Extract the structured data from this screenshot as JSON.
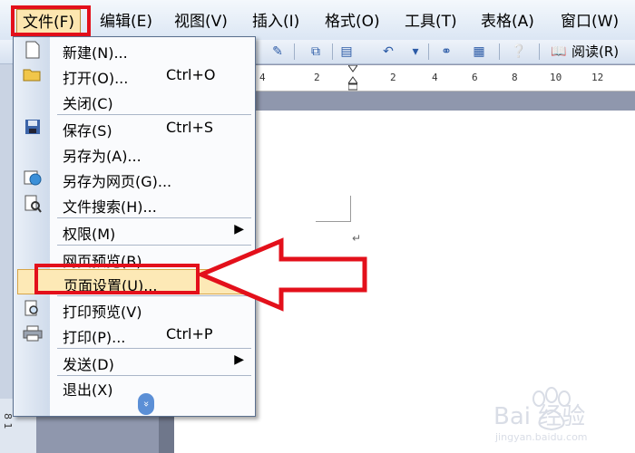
{
  "menubar": {
    "items": [
      {
        "label": "文件(F)",
        "open": true
      },
      {
        "label": "编辑(E)"
      },
      {
        "label": "视图(V)"
      },
      {
        "label": "插入(I)"
      },
      {
        "label": "格式(O)"
      },
      {
        "label": "工具(T)"
      },
      {
        "label": "表格(A)"
      },
      {
        "label": "窗口(W)"
      }
    ]
  },
  "toolbar": {
    "read_label": "阅读(R)",
    "icons": [
      "research-icon",
      "copy-icon",
      "undo-icon",
      "dropdown-arrow-icon",
      "hyperlink-icon",
      "table-icon",
      "help-icon",
      "book-icon"
    ]
  },
  "ruler": {
    "ticks": [
      "4",
      "2",
      "2",
      "4",
      "6",
      "8",
      "10",
      "12"
    ]
  },
  "file_menu": {
    "items": [
      {
        "label": "新建(N)...",
        "shortcut": "",
        "icon": "new-document-icon"
      },
      {
        "label": "打开(O)...",
        "shortcut": "Ctrl+O",
        "icon": "open-folder-icon"
      },
      {
        "label": "关闭(C)",
        "shortcut": "",
        "icon": ""
      },
      {
        "label": "保存(S)",
        "shortcut": "Ctrl+S",
        "icon": "save-disk-icon"
      },
      {
        "label": "另存为(A)...",
        "shortcut": "",
        "icon": ""
      },
      {
        "label": "另存为网页(G)...",
        "shortcut": "",
        "icon": "web-page-icon"
      },
      {
        "label": "文件搜索(H)...",
        "shortcut": "",
        "icon": "file-search-icon"
      },
      {
        "label": "权限(M)",
        "shortcut": "",
        "icon": "",
        "submenu": true
      },
      {
        "label": "网页预览(B)",
        "shortcut": "",
        "icon": ""
      },
      {
        "label": "页面设置(U)...",
        "shortcut": "",
        "icon": "",
        "highlighted": true
      },
      {
        "label": "打印预览(V)",
        "shortcut": "",
        "icon": "print-preview-icon"
      },
      {
        "label": "打印(P)...",
        "shortcut": "Ctrl+P",
        "icon": "printer-icon"
      },
      {
        "label": "发送(D)",
        "shortcut": "",
        "icon": "",
        "submenu": true
      },
      {
        "label": "退出(X)",
        "shortcut": "",
        "icon": ""
      }
    ],
    "expand_glyph": "»"
  },
  "document": {
    "paragraph_mark": "↵"
  },
  "left_ruler_digits": "8 1",
  "watermark": {
    "brand": "Bai 经验",
    "url": "jingyan.baidu.com"
  },
  "colors": {
    "highlight_red": "#e3101b",
    "menu_hover": "#fde9b6",
    "page_bg": "#8f97ad"
  }
}
